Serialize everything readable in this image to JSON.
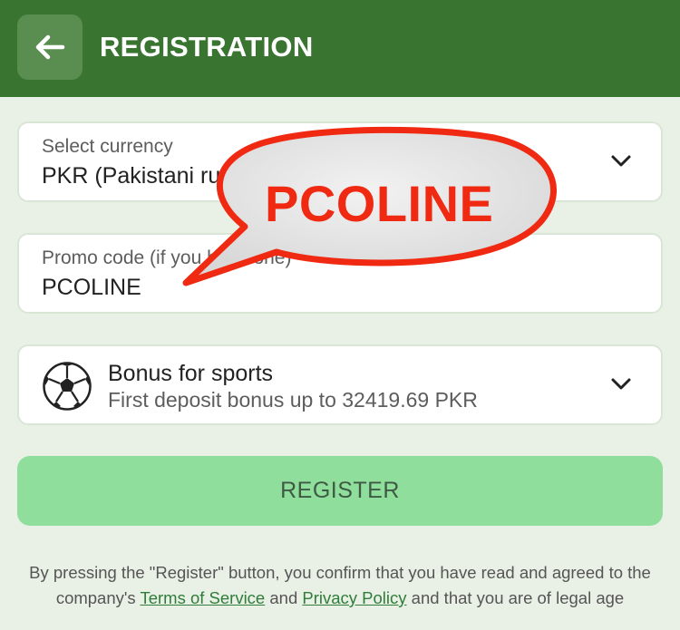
{
  "header": {
    "title": "REGISTRATION",
    "back_icon": "arrow-left-icon"
  },
  "currency": {
    "label": "Select currency",
    "value": "PKR (Pakistani rupee)"
  },
  "promo": {
    "label": "Promo code (if you have one)",
    "value": "PCOLINE"
  },
  "bonus": {
    "title": "Bonus for sports",
    "subtitle": "First deposit bonus up to 32419.69 PKR",
    "icon": "soccer-ball-icon"
  },
  "register": {
    "label": "REGISTER"
  },
  "legal": {
    "text_before": "By pressing the \"Register\" button, you confirm that you have read and agreed to the company's ",
    "terms_link": "Terms of Service",
    "middle": " and ",
    "privacy_link": "Privacy Policy",
    "text_after": " and that you are of legal age"
  },
  "overlay": {
    "bubble_text": "PCOLINE"
  },
  "colors": {
    "header_bg": "#3a7431",
    "page_bg": "#e9f1e6",
    "register_bg": "#8fde9c",
    "link": "#2f7d39",
    "bubble_text": "#f02a12",
    "bubble_fill": "#e6e6e6"
  }
}
